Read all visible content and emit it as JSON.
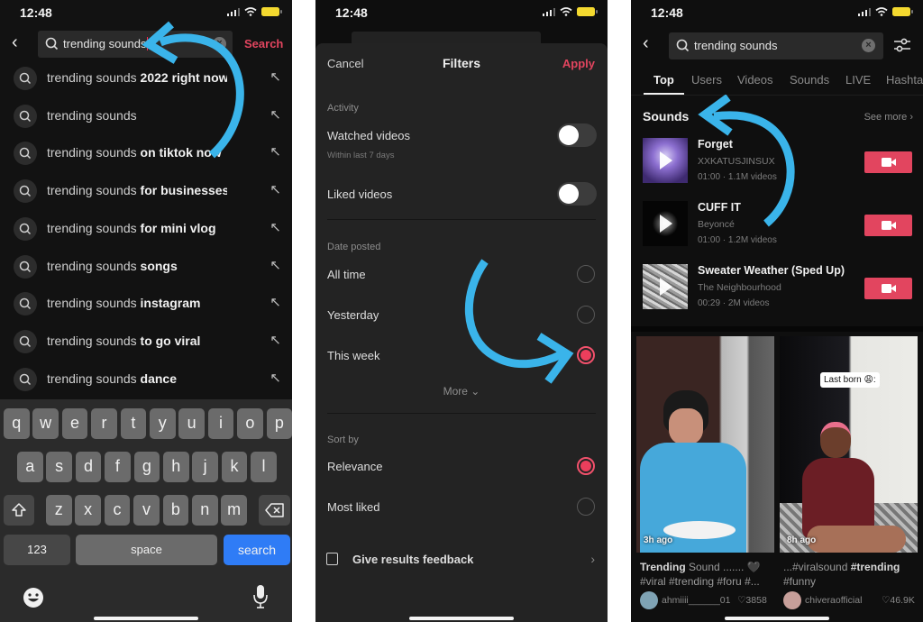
{
  "status_bar": {
    "time": "12:48"
  },
  "panel1": {
    "search_value": "trending sounds",
    "search_button": "Search",
    "suggestions": [
      {
        "prefix": "trending sounds",
        "suffix": " 2022 right now"
      },
      {
        "prefix": "trending sounds",
        "suffix": ""
      },
      {
        "prefix": "trending sounds",
        "suffix": " on tiktok now"
      },
      {
        "prefix": "trending sounds",
        "suffix": " for businesses"
      },
      {
        "prefix": "trending sounds",
        "suffix": " for mini vlog"
      },
      {
        "prefix": "trending sounds",
        "suffix": " songs"
      },
      {
        "prefix": "trending sounds",
        "suffix": " instagram"
      },
      {
        "prefix": "trending sounds",
        "suffix": " to go viral"
      },
      {
        "prefix": "trending sounds",
        "suffix": " dance"
      }
    ],
    "keyboard": {
      "row1": [
        "q",
        "w",
        "e",
        "r",
        "t",
        "y",
        "u",
        "i",
        "o",
        "p"
      ],
      "row2": [
        "a",
        "s",
        "d",
        "f",
        "g",
        "h",
        "j",
        "k",
        "l"
      ],
      "row3": [
        "z",
        "x",
        "c",
        "v",
        "b",
        "n",
        "m"
      ],
      "numbers_key": "123",
      "space_key": "space",
      "search_key": "search"
    }
  },
  "panel2": {
    "cancel": "Cancel",
    "title": "Filters",
    "apply": "Apply",
    "activity_header": "Activity",
    "watched_videos": {
      "label": "Watched videos",
      "sub": "Within last 7 days",
      "on": false
    },
    "liked_videos": {
      "label": "Liked videos",
      "on": false
    },
    "date_header": "Date posted",
    "date_options": [
      {
        "label": "All time",
        "selected": false
      },
      {
        "label": "Yesterday",
        "selected": false
      },
      {
        "label": "This week",
        "selected": true
      }
    ],
    "more": "More",
    "sort_header": "Sort by",
    "sort_options": [
      {
        "label": "Relevance",
        "selected": true
      },
      {
        "label": "Most liked",
        "selected": false
      }
    ],
    "feedback": "Give results feedback"
  },
  "panel3": {
    "search_value": "trending sounds",
    "tabs": [
      "Top",
      "Users",
      "Videos",
      "Sounds",
      "LIVE",
      "Hashta"
    ],
    "active_tab": "Top",
    "sounds_title": "Sounds",
    "see_more": "See more",
    "sounds": [
      {
        "name": "Forget",
        "artist": "XXKATUSJINSUX",
        "meta": "01:00 · 1.1M videos"
      },
      {
        "name": "CUFF IT",
        "artist": "Beyoncé",
        "meta": "01:00 · 1.2M videos"
      },
      {
        "name": "Sweater Weather (Sped Up)",
        "artist": "The Neighbourhood",
        "meta": "00:29 · 2M videos"
      }
    ],
    "videos": [
      {
        "ago": "3h ago",
        "caption_bold": "Trending",
        "caption_rest": " Sound ....... 🖤 #viral #trending #foru #...",
        "user": "ahmiiii______01",
        "likes": "3858"
      },
      {
        "ago": "8h ago",
        "overlay": "Last born 😩:",
        "caption_pre": "...#viralsound ",
        "caption_bold": "#trending",
        "caption_rest": " #funny",
        "user": "chiveraofficial",
        "likes": "46.9K"
      }
    ]
  },
  "colors": {
    "accent": "#e2455f",
    "annotation_arrow": "#3ab4ea",
    "keyboard_search": "#2f7cf6"
  }
}
